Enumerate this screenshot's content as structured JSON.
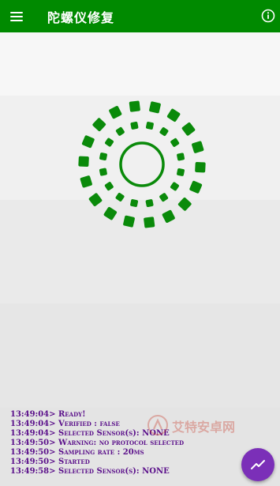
{
  "appbar": {
    "title": "陀螺仪修复",
    "menu_icon": "hamburger-menu-icon",
    "info_icon": "info-circle-icon"
  },
  "colors": {
    "primary": "#008a00",
    "sensor_graphic": "#0a8a0a",
    "log_text": "#5a0f8a",
    "fab": "#7b2fb8"
  },
  "log": {
    "lines": [
      "13:49:04> Ready!",
      "13:49:04> Verified : false",
      "13:49:04> Selected Sensor(s): NONE",
      "13:49:50> Warning: no protocol selected",
      "13:49:50> Sampling rate : 20ms",
      "13:49:50> Started",
      "13:49:58> Selected Sensor(s): NONE"
    ]
  },
  "watermark": {
    "text": "艾特安卓网",
    "logo_icon": "watermark-logo-icon"
  },
  "fab": {
    "icon": "trending-up-chart-icon"
  }
}
